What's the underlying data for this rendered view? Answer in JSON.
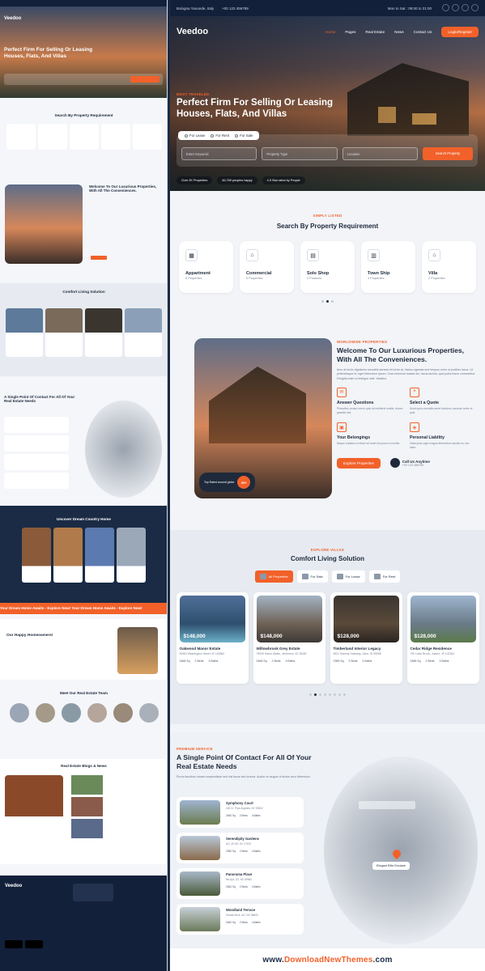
{
  "topbar": {
    "location": "Bologna Yaounde, Italy",
    "phone": "+00 123 456789",
    "hours": "Mon to Sat : 09:00 to 21:00"
  },
  "nav": {
    "logo": "Veedoo",
    "items": [
      "Home",
      "Pages",
      "Real Estate",
      "News",
      "Contact Us"
    ],
    "login": "Login/Register"
  },
  "hero": {
    "eyebrow": "MOST TRAVELED",
    "title": "Perfect Firm For Selling Or Leasing Houses, Flats, And Villas",
    "radios": [
      "For Lease",
      "For Rent",
      "For Sale"
    ],
    "keyword": "Enter Keyword",
    "type": "Property Type",
    "location": "Location",
    "search": "Search Property",
    "stat1": "Over 2K Properties",
    "stat2": "46,769 peoples happy",
    "stat3": "4.5 Star rated by People"
  },
  "categories": {
    "eyebrow": "SIMPLY LISTED",
    "title": "Search By Property Requirement",
    "items": [
      {
        "name": "Appartment",
        "count": "6 Properties",
        "icon": "building-icon"
      },
      {
        "name": "Commercial",
        "count": "5 Properties",
        "icon": "shop-icon"
      },
      {
        "name": "Solo Shop",
        "count": "2 Products",
        "icon": "store-icon"
      },
      {
        "name": "Town Ship",
        "count": "4 Properties",
        "icon": "township-icon"
      },
      {
        "name": "Villa",
        "count": "2 Properties",
        "icon": "villa-icon"
      }
    ]
  },
  "welcome": {
    "eyebrow": "WORLDWIDE PROPERTIES",
    "title": "Welcome To Our Luxurious Properties, With All The Conveniences.",
    "para": "Arcu at tortor dignissim convallis aenean et tortor at. Varius egestas sed tempus enim ut porttitor lacus. Ut pellentesque id, eget bibendum ipsum. Cras euismod massa dui, lacus lacinia, quis porta fusce consectetur. Fringilla enim ut tristique velit. Vestibul.",
    "features": [
      {
        "t": "Answer Questions",
        "p": "Phasellus ornare lorem quis dui eleifend mattis, donec gravida nisi.",
        "icon": "chat-icon"
      },
      {
        "t": "Select a Quote",
        "p": "Morbi quis convallis amet tincidunt, aenean tortor et quis.",
        "icon": "quote-icon"
      },
      {
        "t": "Your Belongings",
        "p": "Neque sodales ut etiam sit amet nisl purus in mollis.",
        "icon": "box-icon"
      },
      {
        "t": "Personal Liability",
        "p": "Vitae justo eget magna fermentum iaculis eu non diam.",
        "icon": "shield-icon"
      }
    ],
    "button": "Explore Properties",
    "call_label": "Call Us Anytime",
    "call_number": "+00 123 456789",
    "badge": "Top Rated around globe",
    "badge_count": "69+"
  },
  "comfort": {
    "eyebrow": "EXPLORE VILLAS",
    "title": "Comfort Living Solution",
    "tabs": [
      "All Properties",
      "For Sale",
      "For Lease",
      "For Rent"
    ],
    "props": [
      {
        "price": "$148,000",
        "name": "Oakwood Manor Estate",
        "addr": "30963 Washington Street, ID 163582",
        "sqft": "2468 Sq",
        "beds": "2 Beds",
        "baths": "3 Baths"
      },
      {
        "price": "$148,000",
        "name": "Willowbrook Grey Estate",
        "addr": "75925 Harris Walks, Jerimeton, ID 28435",
        "sqft": "2468 Sq",
        "beds": "2 Beds",
        "baths": "3 Baths"
      },
      {
        "price": "$128,000",
        "name": "Timberland Interior Legacy",
        "addr": "6521 Sammy Gateway, Jarm, ID 55958",
        "sqft": "2355 Sq",
        "beds": "2 Beds",
        "baths": "4 Baths"
      },
      {
        "price": "$128,000",
        "name": "Cedar Ridge Residence",
        "addr": "750 Lakin Brook, Juarez, JP 102361",
        "sqft": "2468 Sq",
        "beds": "2 Beds",
        "baths": "3 Baths"
      }
    ]
  },
  "contact": {
    "eyebrow": "PREMIUM SERVICE",
    "title": "A Single Point Of Contact For All Of Your Real Estate Needs",
    "para": "Purus faucibus ornare suspendisse sed nisi lacus sed viverra. Auctor eu augue ut lectus arcu bibendum.",
    "items": [
      {
        "name": "Symphony Court",
        "addr": "160 N., Pipe Angeles, NY 93502",
        "sqft": "2460 Sq",
        "beds": "2 Beds",
        "baths": "4 Baths"
      },
      {
        "name": "Serendipity Gardens",
        "addr": "AG, 2H 0D, NY 27670",
        "sqft": "2350 Sq",
        "beds": "2 Beds",
        "baths": "4 Baths"
      },
      {
        "name": "Panorama Place",
        "addr": "9th Apt, 2G, NV 89960",
        "sqft": "2460 Sq",
        "beds": "2 Beds",
        "baths": "4 Baths"
      },
      {
        "name": "Woodland Terrace",
        "addr": "Kerala Drive, AG, NV 56609",
        "sqft": "2460 Sq",
        "beds": "2 Beds",
        "baths": "4 Baths"
      }
    ],
    "map_label": "Elegant Elite Enclave"
  },
  "left": {
    "comfort": "Comfort Living Solution",
    "single": "A Single Point Of Contact For All Of Your Real Estate Needs",
    "country": "Uncover Dream Country Home",
    "cities": [
      "Bristol",
      "Fez",
      "Friday",
      "Rajshah"
    ],
    "ticker": "Your Dream Home Awaits - Explore Now!   Your Dream Home Awaits - Explore Now!",
    "happy": "Our Happy Homeowners!",
    "team": "Meet Our Real Estate Team",
    "members": [
      "Jackie Barrett",
      "Brian Halloran",
      "Carl Williams",
      "Jason Rivera",
      "John Ray",
      "Lucas Richards"
    ],
    "blogs": "Real Estate Blogs & News",
    "brands": [
      "APTDIR",
      "Onhadi",
      "HOUSEZ",
      "Urling",
      "YAGUS",
      "Brightlio"
    ]
  },
  "watermark": {
    "pre": "www.",
    "brand": "DownloadNewThemes",
    ".com": ".com"
  },
  "colors": {
    "accent": "#f2612a",
    "navy": "#13203a"
  }
}
